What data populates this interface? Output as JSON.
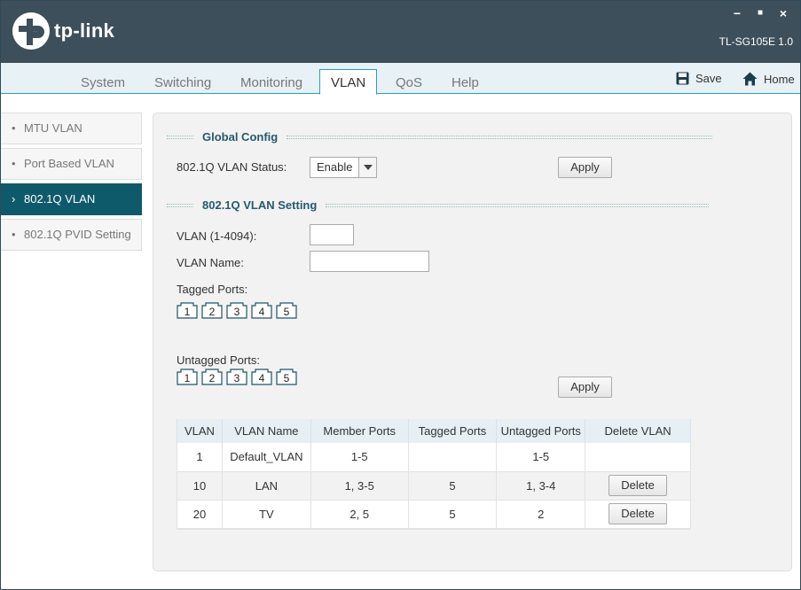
{
  "app": {
    "brand": "tp-link",
    "model": "TL-SG105E 1.0"
  },
  "window_controls": {
    "minimize": "−",
    "maximize": "■",
    "close": "×"
  },
  "tabs": [
    {
      "label": "System"
    },
    {
      "label": "Switching"
    },
    {
      "label": "Monitoring"
    },
    {
      "label": "VLAN"
    },
    {
      "label": "QoS"
    },
    {
      "label": "Help"
    }
  ],
  "toolbar": {
    "save_label": "Save",
    "home_label": "Home"
  },
  "sidebar": {
    "items": [
      {
        "label": "MTU VLAN",
        "bullet": "•"
      },
      {
        "label": "Port Based VLAN",
        "bullet": "•"
      },
      {
        "label": "802.1Q VLAN",
        "bullet": "›"
      },
      {
        "label": "802.1Q PVID Setting",
        "bullet": "•"
      }
    ]
  },
  "global_config": {
    "title": "Global Config",
    "status_label": "802.1Q VLAN Status:",
    "status_value": "Enable",
    "apply_label": "Apply"
  },
  "vlan_setting": {
    "title": "802.1Q VLAN Setting",
    "vlan_id_label": "VLAN (1-4094):",
    "vlan_id_value": "",
    "vlan_name_label": "VLAN Name:",
    "vlan_name_value": "",
    "tagged_label": "Tagged Ports:",
    "untagged_label": "Untagged Ports:",
    "ports": [
      "1",
      "2",
      "3",
      "4",
      "5"
    ],
    "apply_label": "Apply"
  },
  "vlan_table": {
    "headers": [
      "VLAN",
      "VLAN Name",
      "Member Ports",
      "Tagged Ports",
      "Untagged Ports",
      "Delete VLAN"
    ],
    "rows": [
      {
        "vlan": "1",
        "name": "Default_VLAN",
        "member": "1-5",
        "tagged": "",
        "untagged": "1-5",
        "delete": ""
      },
      {
        "vlan": "10",
        "name": "LAN",
        "member": "1, 3-5",
        "tagged": "5",
        "untagged": "1, 3-4",
        "delete": "Delete"
      },
      {
        "vlan": "20",
        "name": "TV",
        "member": "2, 5",
        "tagged": "5",
        "untagged": "2",
        "delete": "Delete"
      }
    ]
  },
  "colors": {
    "titlebar": "#3d4f5a",
    "accent": "#2a9bc4",
    "sidebar_active": "#0f5a6a"
  }
}
